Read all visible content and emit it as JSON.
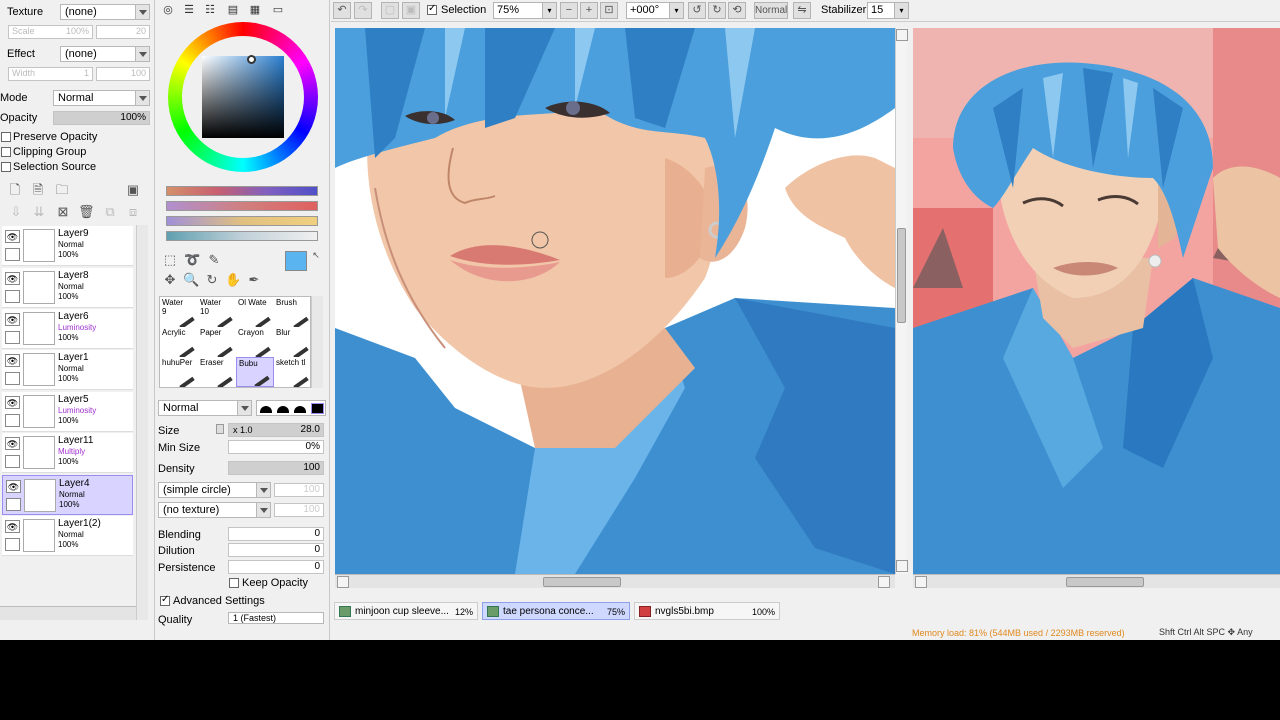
{
  "left": {
    "texture_label": "Texture",
    "texture_value": "(none)",
    "scale_label": "Scale",
    "scale_value": "100%",
    "scale_num": "20",
    "effect_label": "Effect",
    "effect_value": "(none)",
    "width_label": "Width",
    "width_value": "1",
    "width_num": "100",
    "mode_label": "Mode",
    "mode_value": "Normal",
    "opacity_label": "Opacity",
    "opacity_value": "100%",
    "preserve_opacity": "Preserve Opacity",
    "clipping_group": "Clipping Group",
    "selection_source": "Selection Source",
    "layers": [
      {
        "name": "Layer9",
        "mode": "Normal",
        "opacity": "100%"
      },
      {
        "name": "Layer8",
        "mode": "Normal",
        "opacity": "100%"
      },
      {
        "name": "Layer6",
        "mode": "Luminosity",
        "opacity": "100%"
      },
      {
        "name": "Layer1",
        "mode": "Normal",
        "opacity": "100%"
      },
      {
        "name": "Layer5",
        "mode": "Luminosity",
        "opacity": "100%"
      },
      {
        "name": "Layer11",
        "mode": "Multiply",
        "opacity": "100%"
      },
      {
        "name": "Layer4",
        "mode": "Normal",
        "opacity": "100%"
      },
      {
        "name": "Layer1(2)",
        "mode": "Normal",
        "opacity": "100%"
      }
    ]
  },
  "tools": {
    "grid": [
      {
        "name": "Water",
        "sub": "9"
      },
      {
        "name": "Water",
        "sub": "10"
      },
      {
        "name": "Ol Wate",
        "sub": ""
      },
      {
        "name": "Brush",
        "sub": ""
      },
      {
        "name": "Acrylic",
        "sub": ""
      },
      {
        "name": "Paper",
        "sub": ""
      },
      {
        "name": "Crayon",
        "sub": ""
      },
      {
        "name": "Blur",
        "sub": ""
      },
      {
        "name": "huhuPer",
        "sub": ""
      },
      {
        "name": "Eraser",
        "sub": ""
      },
      {
        "name": "Bubu",
        "sub": ""
      },
      {
        "name": "sketch tl",
        "sub": ""
      }
    ],
    "blend_mode": "Normal",
    "size_label": "Size",
    "size_mult": "x 1.0",
    "size_value": "28.0",
    "min_size_label": "Min Size",
    "min_size_value": "0%",
    "density_label": "Density",
    "density_value": "100",
    "shape": "(simple circle)",
    "shape_num": "100",
    "texture": "(no texture)",
    "texture_num": "100",
    "blending_label": "Blending",
    "blending_value": "0",
    "dilution_label": "Dilution",
    "dilution_value": "0",
    "persistence_label": "Persistence",
    "persistence_value": "0",
    "keep_opacity": "Keep Opacity",
    "advanced_settings": "Advanced Settings",
    "quality_label": "Quality",
    "quality_value": "1 (Fastest)"
  },
  "toolbar": {
    "selection_label": "Selection",
    "zoom": "75%",
    "angle": "+000°",
    "blend": "Normal",
    "stabilizer_label": "Stabilizer",
    "stabilizer_value": "15"
  },
  "tabs": [
    {
      "name": "minjoon cup sleeve...",
      "zoom": "12%"
    },
    {
      "name": "tae persona conce...",
      "zoom": "75%"
    },
    {
      "name": "nvgls5bi.bmp",
      "zoom": "100%"
    }
  ],
  "status": {
    "memory": "Memory load: 81% (544MB used / 2293MB reserved)",
    "keys": "Shft Ctrl Alt SPC ✥ Any"
  },
  "colors": {
    "hair": "#4a9fdc",
    "skin": "#f2c6a8",
    "shirt": "#3d8fd0",
    "photo_bg": "#f4a4a0",
    "current_color": "#5ab4f0"
  }
}
